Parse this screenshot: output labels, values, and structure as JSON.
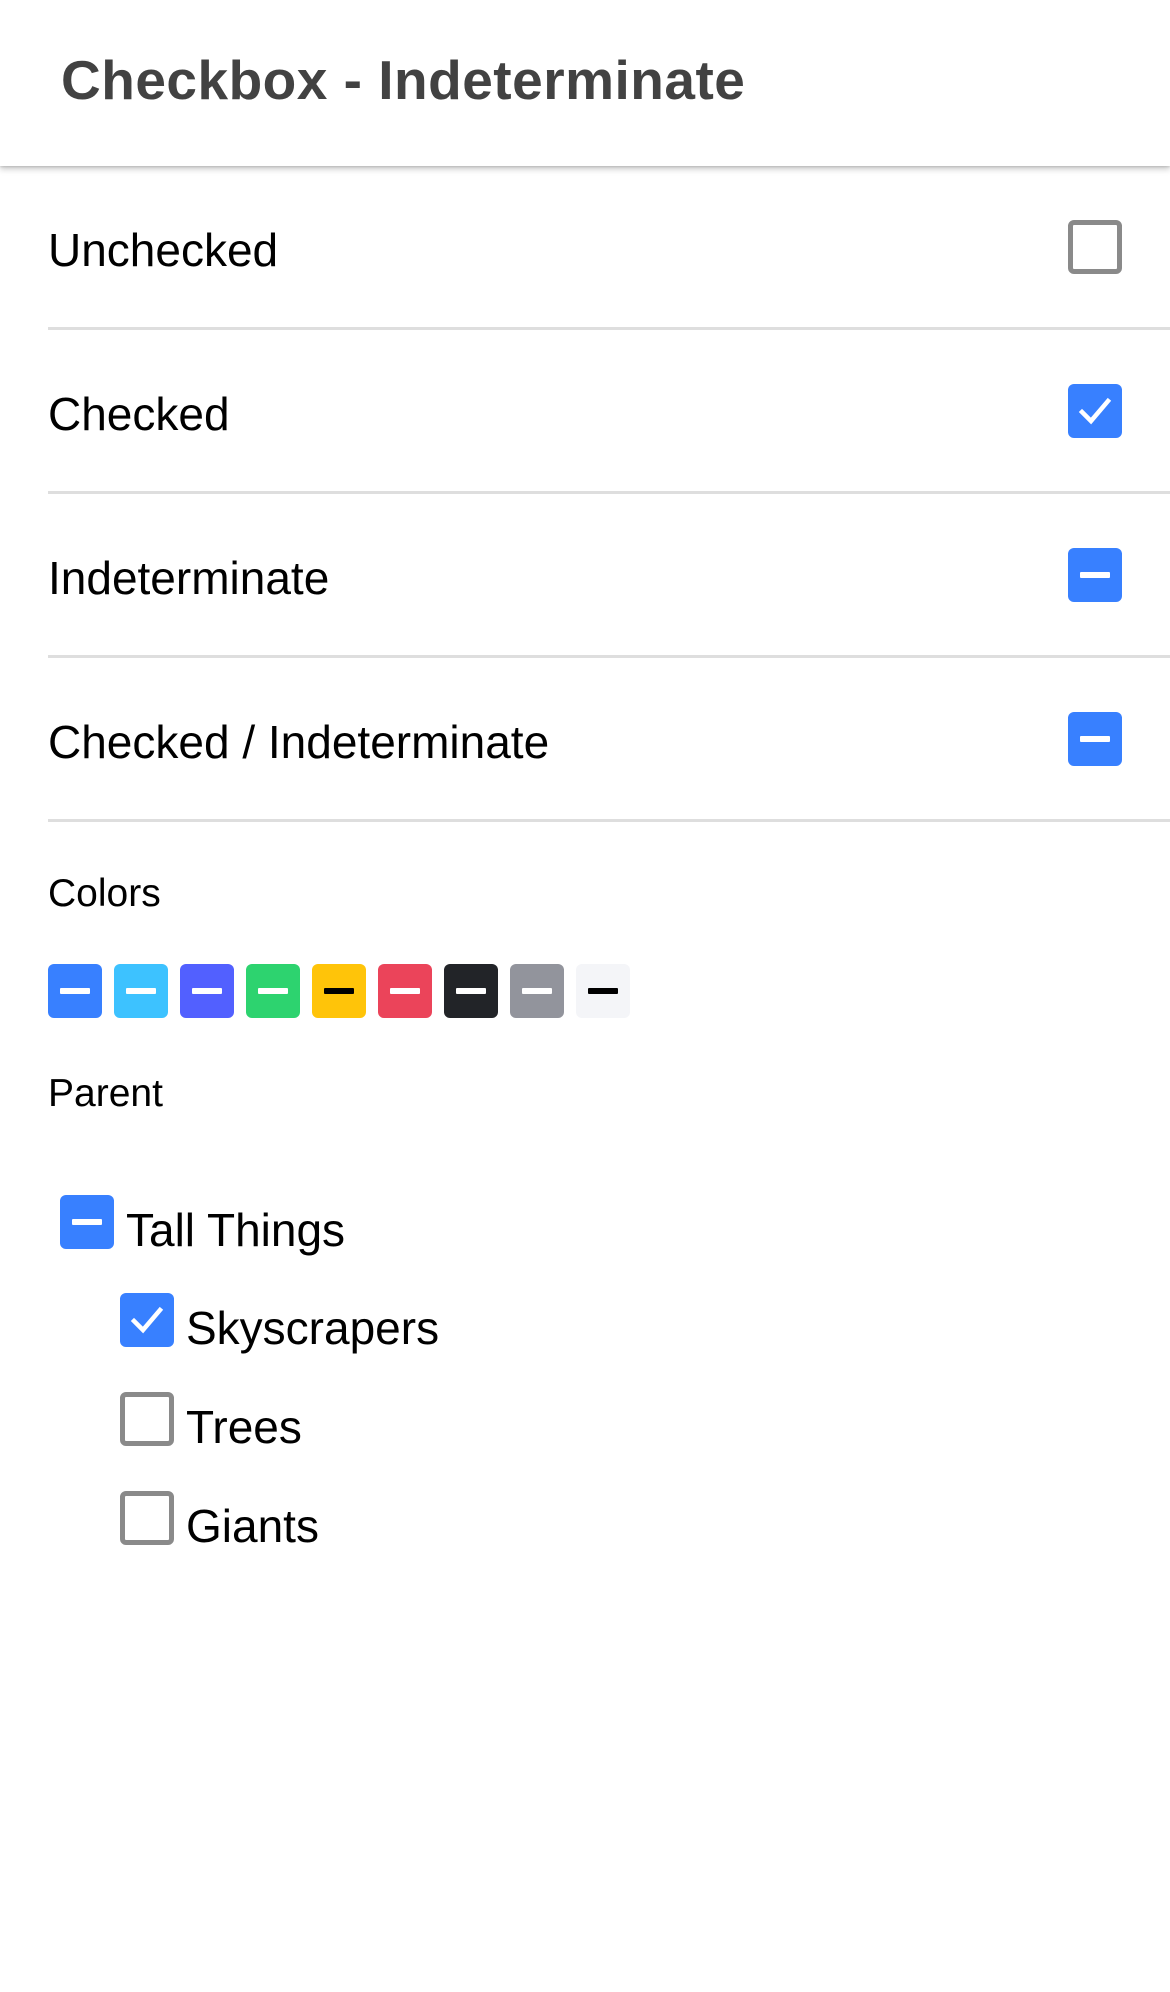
{
  "header": {
    "title": "Checkbox - Indeterminate"
  },
  "items": [
    {
      "label": "Unchecked",
      "state": "unchecked"
    },
    {
      "label": "Checked",
      "state": "checked"
    },
    {
      "label": "Indeterminate",
      "state": "indeterminate"
    },
    {
      "label": "Checked / Indeterminate",
      "state": "indeterminate"
    }
  ],
  "colors_section": {
    "label": "Colors",
    "swatches": [
      {
        "name": "primary",
        "bg": "#3880ff",
        "dash": "#ffffff"
      },
      {
        "name": "secondary",
        "bg": "#3dc2ff",
        "dash": "#ffffff"
      },
      {
        "name": "tertiary",
        "bg": "#5260ff",
        "dash": "#ffffff"
      },
      {
        "name": "success",
        "bg": "#2dd36f",
        "dash": "#ffffff"
      },
      {
        "name": "warning",
        "bg": "#ffc409",
        "dash": "#000000"
      },
      {
        "name": "danger",
        "bg": "#eb445a",
        "dash": "#ffffff"
      },
      {
        "name": "dark",
        "bg": "#222428",
        "dash": "#ffffff"
      },
      {
        "name": "medium",
        "bg": "#92949c",
        "dash": "#ffffff"
      },
      {
        "name": "light",
        "bg": "#f4f5f8",
        "dash": "#000000"
      }
    ]
  },
  "parent_section": {
    "label": "Parent",
    "parent": {
      "label": "Tall Things",
      "state": "indeterminate"
    },
    "children": [
      {
        "label": "Skyscrapers",
        "state": "checked"
      },
      {
        "label": "Trees",
        "state": "unchecked"
      },
      {
        "label": "Giants",
        "state": "unchecked"
      }
    ]
  },
  "accent_color": "#3880ff"
}
